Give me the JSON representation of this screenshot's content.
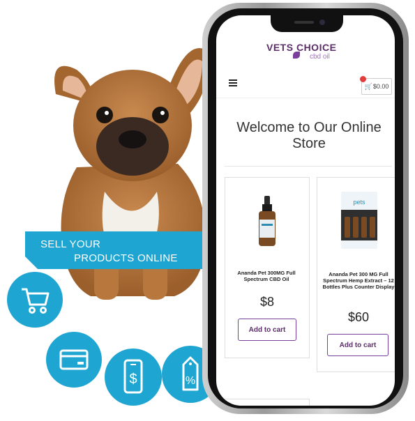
{
  "banner": {
    "line1": "SELL YOUR",
    "line2": "PRODUCTS ONLINE"
  },
  "feature_icons": [
    "cart-icon",
    "credit-card-icon",
    "mobile-payment-icon",
    "discount-tag-icon"
  ],
  "accent_color": "#1ea5d1",
  "brand_color": "#5b2d69",
  "store": {
    "logo": {
      "name": "VETS CHOICE",
      "sub": "cbd oil"
    },
    "cart_total": "$0.00",
    "welcome": "Welcome to Our Online Store",
    "products": [
      {
        "name": "Ananda Pet 300MG Full Spectrum CBD Oil",
        "price": "$8",
        "button": "Add to cart"
      },
      {
        "name": "Ananda Pet 300 MG Full Spectrum Hemp Extract – 12 Bottles Plus Counter Display",
        "price": "$60",
        "button": "Add to cart"
      }
    ]
  }
}
